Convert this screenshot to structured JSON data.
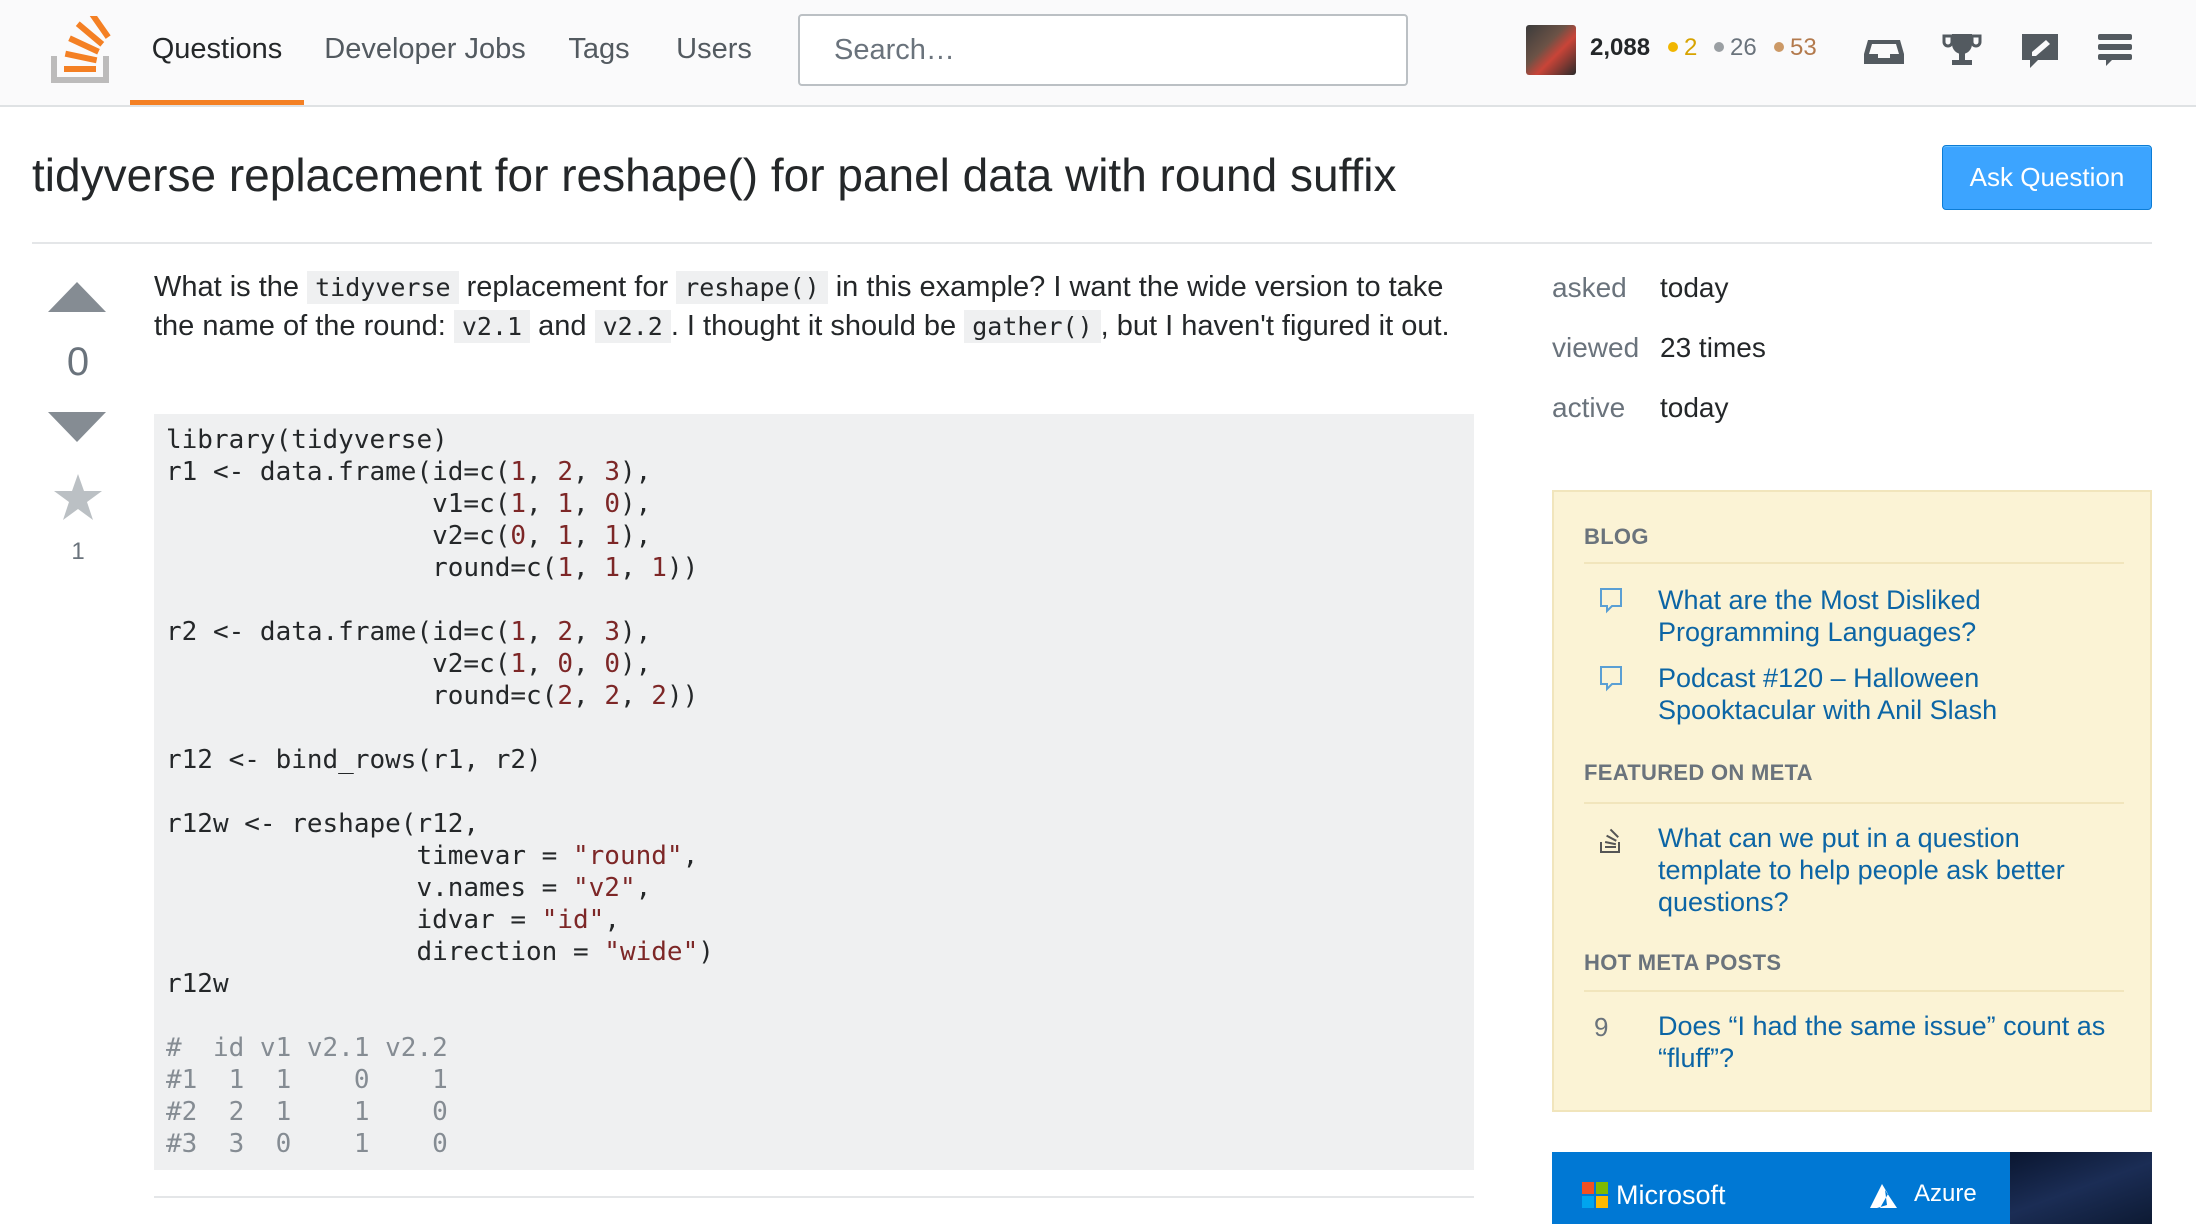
{
  "nav": {
    "questions": "Questions",
    "developer_jobs": "Developer Jobs",
    "tags": "Tags",
    "users": "Users",
    "search_placeholder": "Search…"
  },
  "user": {
    "reputation": "2,088",
    "gold": "2",
    "silver": "26",
    "bronze": "53"
  },
  "question": {
    "title": "tidyverse replacement for reshape() for panel data with round suffix",
    "ask_button": "Ask Question",
    "votes": "0",
    "favorites": "1",
    "text_1": "What is the ",
    "code_1": "tidyverse",
    "text_2": " replacement for ",
    "code_2": "reshape()",
    "text_3": " in this example? I want the wide version to take the name of the round: ",
    "code_3": "v2.1",
    "text_4": " and ",
    "code_4": "v2.2",
    "text_5": ". I thought it should be ",
    "code_5": "gather()",
    "text_6": ", but I haven't figured it out."
  },
  "stats": {
    "asked_label": "asked",
    "asked_value": "today",
    "viewed_label": "viewed",
    "viewed_value": "23 times",
    "active_label": "active",
    "active_value": "today"
  },
  "sidebar": {
    "blog_heading": "BLOG",
    "blog_1": "What are the Most Disliked Programming Languages?",
    "blog_2": "Podcast #120 – Halloween Spooktacular with Anil Slash",
    "featured_heading": "FEATURED ON META",
    "featured_1": "What can we put in a question template to help people ask better questions?",
    "hot_heading": "HOT META POSTS",
    "hot_1_count": "9",
    "hot_1": "Does “I had the same issue” count as “fluff”?"
  },
  "ad": {
    "brand": "Microsoft",
    "product": "Azure"
  },
  "colors": {
    "accent": "#f48024",
    "link": "#0c65a5",
    "button": "#3ca4ff",
    "gold": "#f1b600",
    "silver": "#9a9fa3",
    "bronze": "#cc9966"
  }
}
